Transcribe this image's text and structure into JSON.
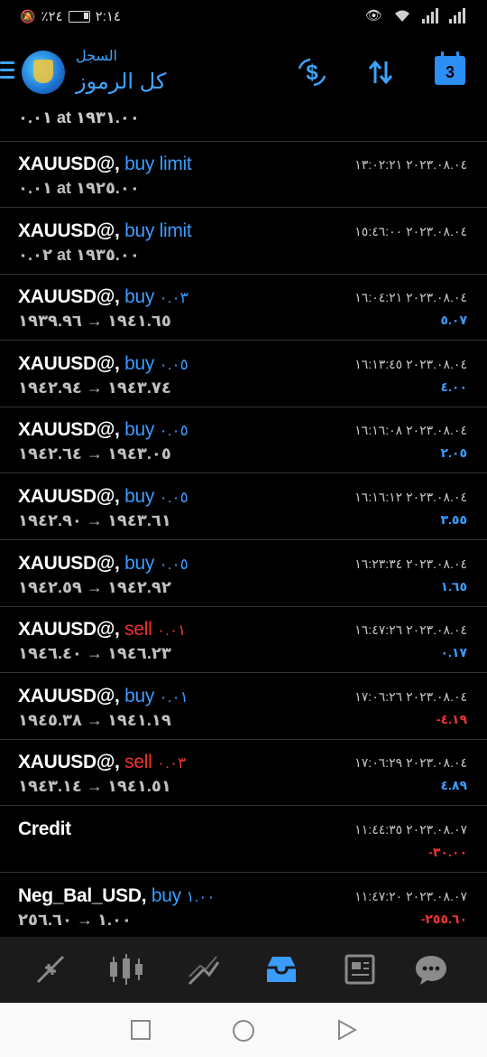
{
  "status": {
    "time": "٢:١٤",
    "battery": "٢٤٪"
  },
  "header": {
    "subtitle": "السجل",
    "title": "كل الرموز",
    "calendar_day": "3"
  },
  "partial_row": {
    "line2": "٠.٠١ at ١٩٣١.٠٠"
  },
  "rows": [
    {
      "symbol": "XAUUSD@,",
      "action": "buy limit",
      "action_color": "#3a9cff",
      "volume": "",
      "line2": "٠.٠١ at ١٩٢٥.٠٠",
      "time": "٢٠٢٣.٠٨.٠٤ ١٣:٠٢:٢١",
      "profit": "",
      "profit_color": "#3a9cff"
    },
    {
      "symbol": "XAUUSD@,",
      "action": "buy limit",
      "action_color": "#3a9cff",
      "volume": "",
      "line2": "٠.٠٢ at ١٩٣٥.٠٠",
      "time": "٢٠٢٣.٠٨.٠٤ ١٥:٤٦:٠٠",
      "profit": "",
      "profit_color": "#3a9cff"
    },
    {
      "symbol": "XAUUSD@,",
      "action": "buy",
      "action_color": "#3a9cff",
      "volume": "٠.٠٣",
      "line2": "١٩٤١.٦٥ → ١٩٣٩.٩٦",
      "time": "٢٠٢٣.٠٨.٠٤ ١٦:٠٤:٢١",
      "profit": "٥.٠٧",
      "profit_color": "#3a9cff"
    },
    {
      "symbol": "XAUUSD@,",
      "action": "buy",
      "action_color": "#3a9cff",
      "volume": "٠.٠٥",
      "line2": "١٩٤٣.٧٤ → ١٩٤٢.٩٤",
      "time": "٢٠٢٣.٠٨.٠٤ ١٦:١٣:٤٥",
      "profit": "٤.٠٠",
      "profit_color": "#3a9cff"
    },
    {
      "symbol": "XAUUSD@,",
      "action": "buy",
      "action_color": "#3a9cff",
      "volume": "٠.٠٥",
      "line2": "١٩٤٣.٠٥ → ١٩٤٢.٦٤",
      "time": "٢٠٢٣.٠٨.٠٤ ١٦:١٦:٠٨",
      "profit": "٢.٠٥",
      "profit_color": "#3a9cff"
    },
    {
      "symbol": "XAUUSD@,",
      "action": "buy",
      "action_color": "#3a9cff",
      "volume": "٠.٠٥",
      "line2": "١٩٤٣.٦١ → ١٩٤٢.٩٠",
      "time": "٢٠٢٣.٠٨.٠٤ ١٦:١٦:١٢",
      "profit": "٣.٥٥",
      "profit_color": "#3a9cff"
    },
    {
      "symbol": "XAUUSD@,",
      "action": "buy",
      "action_color": "#3a9cff",
      "volume": "٠.٠٥",
      "line2": "١٩٤٢.٩٢ → ١٩٤٢.٥٩",
      "time": "٢٠٢٣.٠٨.٠٤ ١٦:٢٣:٣٤",
      "profit": "١.٦٥",
      "profit_color": "#3a9cff"
    },
    {
      "symbol": "XAUUSD@,",
      "action": "sell",
      "action_color": "#f03333",
      "volume": "٠.٠١",
      "line2": "١٩٤٦.٢٣ → ١٩٤٦.٤٠",
      "time": "٢٠٢٣.٠٨.٠٤ ١٦:٤٧:٢٦",
      "profit": "٠.١٧",
      "profit_color": "#3a9cff"
    },
    {
      "symbol": "XAUUSD@,",
      "action": "buy",
      "action_color": "#3a9cff",
      "volume": "٠.٠١",
      "line2": "١٩٤١.١٩ → ١٩٤٥.٣٨",
      "time": "٢٠٢٣.٠٨.٠٤ ١٧:٠٦:٢٦",
      "profit": "-٤.١٩",
      "profit_color": "#f03333"
    },
    {
      "symbol": "XAUUSD@,",
      "action": "sell",
      "action_color": "#f03333",
      "volume": "٠.٠٣",
      "line2": "١٩٤١.٥١ → ١٩٤٣.١٤",
      "time": "٢٠٢٣.٠٨.٠٤ ١٧:٠٦:٢٩",
      "profit": "٤.٨٩",
      "profit_color": "#3a9cff"
    },
    {
      "symbol": "Credit",
      "action": "",
      "action_color": "#3a9cff",
      "volume": "",
      "line2": "",
      "time": "٢٠٢٣.٠٨.٠٧ ١١:٤٤:٣٥",
      "profit": "-٣٠.٠٠",
      "profit_color": "#f03333"
    },
    {
      "symbol": "Neg_Bal_USD,",
      "action": "buy",
      "action_color": "#3a9cff",
      "volume": "١.٠٠",
      "line2": "١.٠٠ → ٢٥٦.٦٠",
      "time": "٢٠٢٣.٠٨.٠٧ ١١:٤٧:٢٠",
      "profit": "-٢٥٥.٦٠",
      "profit_color": "#f03333"
    }
  ],
  "bottom_nav": [
    {
      "name": "quotes-nav-icon",
      "active": false
    },
    {
      "name": "chart-nav-icon",
      "active": false
    },
    {
      "name": "trade-nav-icon",
      "active": false
    },
    {
      "name": "history-nav-icon",
      "active": true
    },
    {
      "name": "news-nav-icon",
      "active": false
    },
    {
      "name": "chat-nav-icon",
      "active": false
    }
  ],
  "colors": {
    "accent": "#3a9cff",
    "loss": "#f03333",
    "background": "#000000",
    "nav_background": "#1b1b1b"
  }
}
